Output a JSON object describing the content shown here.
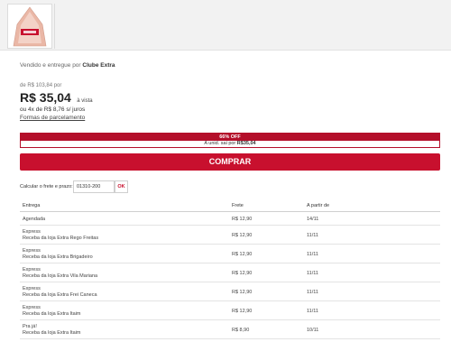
{
  "product": {
    "seller_prefix": "Vendido e entregue por ",
    "seller_name": "Clube Extra"
  },
  "price": {
    "old": "de R$ 103,84 por",
    "current": "R$ 35,04",
    "cash_note": "à vista",
    "installment": "ou 4x de R$ 8,76 s/ juros",
    "payment_link": "Formas de parcelamento"
  },
  "promo": {
    "badge": "66% OFF",
    "unit_prefix": "A unid. sai por ",
    "unit_price": "R$35,04"
  },
  "buy_button": "COMPRAR",
  "shipping": {
    "label": "Calcular o frete e prazo:",
    "cep_value": "01310-200",
    "ok_label": "OK",
    "headers": {
      "delivery": "Entrega",
      "freight": "Frete",
      "from": "A partir de"
    },
    "rows": [
      {
        "type": "Agendada",
        "store": "",
        "price": "R$ 12,90",
        "date": "14/11"
      },
      {
        "type": "Express",
        "store": "Receba da loja Extra Rego Freitas",
        "price": "R$ 12,90",
        "date": "11/11"
      },
      {
        "type": "Express",
        "store": "Receba da loja Extra Brigadeiro",
        "price": "R$ 12,90",
        "date": "11/11"
      },
      {
        "type": "Express",
        "store": "Receba da loja Extra Vila Mariana",
        "price": "R$ 12,90",
        "date": "11/11"
      },
      {
        "type": "Express",
        "store": "Receba da loja Extra Frei Caneca",
        "price": "R$ 12,90",
        "date": "11/11"
      },
      {
        "type": "Express",
        "store": "Receba da loja Extra Itaim",
        "price": "R$ 12,90",
        "date": "11/11"
      },
      {
        "type": "Pra já!",
        "store": "Receba da loja Extra Itaim",
        "price": "R$ 8,90",
        "date": "10/11"
      }
    ]
  },
  "colors": {
    "brand_red": "#c8102e",
    "promo_red": "#b40f2a"
  }
}
